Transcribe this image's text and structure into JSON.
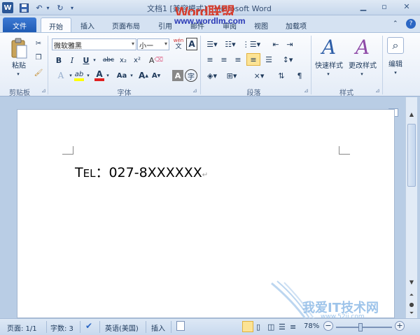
{
  "title_bar": {
    "title": "文档1 [兼容模式] - Microsoft Word",
    "watermark_logo": "Word联盟",
    "watermark_url": "www.wordlm.com",
    "undo_arrow": "▾",
    "qat_customize": "▾"
  },
  "tabs": [
    "文件",
    "开始",
    "插入",
    "页面布局",
    "引用",
    "邮件",
    "审阅",
    "视图",
    "加载项"
  ],
  "ribbon": {
    "clipboard": {
      "label": "剪贴板",
      "paste": "粘贴"
    },
    "font": {
      "label": "字体",
      "font_name": "微软雅黑",
      "font_size": "小一",
      "grow": "A",
      "shrink": "A",
      "bold": "B",
      "italic": "I",
      "underline": "U",
      "strike": "abc",
      "sub": "x₂",
      "sup": "x²",
      "case": "Aa",
      "clear": "A",
      "char_shade": "A",
      "enclose": "字",
      "wen": "wén",
      "phonetic": "文",
      "border_char": "A",
      "highlight": "ab",
      "font_color": "A"
    },
    "paragraph": {
      "label": "段落"
    },
    "styles": {
      "label": "样式",
      "quick_styles": "快速样式",
      "change_styles": "更改样式"
    },
    "editing": {
      "label": "编辑"
    }
  },
  "document": {
    "text_prefix": "T",
    "text_smallcaps": "EL",
    "text_rest": "：027-8XXXXXX",
    "paragraph_mark": "↵"
  },
  "status": {
    "page": "页面: 1/1",
    "words": "字数: 3",
    "language": "英语(美国)",
    "mode": "插入",
    "zoom": "78%"
  },
  "watermark": {
    "text": "我爱IT技术网",
    "url": "www.52ij.com"
  },
  "colors": {
    "file_tab": "#2b66c4",
    "highlight": "#ffff00",
    "font_color": "#e02020",
    "accent": "#1e395b"
  }
}
